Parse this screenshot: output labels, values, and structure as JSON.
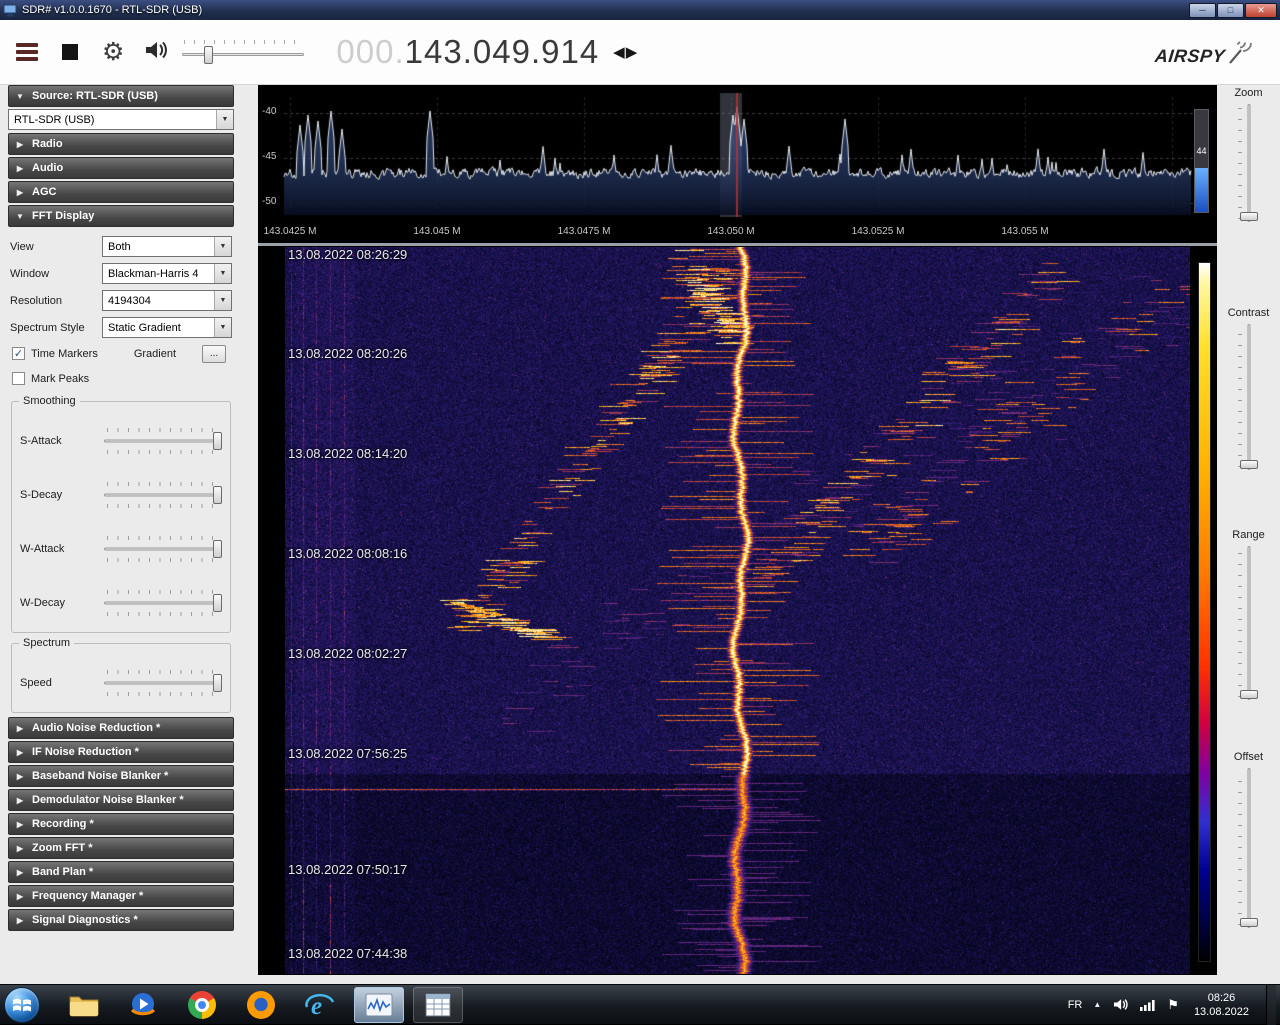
{
  "window": {
    "title": "SDR# v1.0.0.1670 - RTL-SDR (USB)"
  },
  "toolbar": {
    "frequency_dim": "000.",
    "frequency_main": "143.049.914",
    "brand": "AIRSPY"
  },
  "sidebar": {
    "panels": {
      "source": {
        "title": "Source: RTL-SDR (USB)",
        "value": "RTL-SDR (USB)"
      },
      "radio": "Radio",
      "audio": "Audio",
      "agc": "AGC",
      "fft": "FFT Display"
    },
    "fft": {
      "rows": [
        {
          "label": "View",
          "value": "Both"
        },
        {
          "label": "Window",
          "value": "Blackman-Harris 4"
        },
        {
          "label": "Resolution",
          "value": "4194304"
        },
        {
          "label": "Spectrum Style",
          "value": "Static Gradient"
        }
      ],
      "time_markers": "Time Markers",
      "gradient": "Gradient",
      "gradient_button": "...",
      "mark_peaks": "Mark Peaks",
      "smoothing_title": "Smoothing",
      "smoothing_sliders": [
        "S-Attack",
        "S-Decay",
        "W-Attack",
        "W-Decay"
      ],
      "spectrum_title": "Spectrum",
      "spectrum_sliders": [
        "Speed"
      ]
    },
    "collapsed": [
      "Audio Noise Reduction *",
      "IF Noise Reduction *",
      "Baseband Noise Blanker *",
      "Demodulator Noise Blanker *",
      "Recording *",
      "Zoom FFT *",
      "Band Plan *",
      "Frequency Manager *",
      "Signal Diagnostics *"
    ]
  },
  "spectrum": {
    "y_ticks": [
      "-40",
      "-45",
      "-50"
    ],
    "x_ticks": [
      "143.0425 M",
      "143.045 M",
      "143.0475 M",
      "143.050 M",
      "143.0525 M",
      "143.055 M"
    ],
    "meter_value": "44"
  },
  "waterfall": {
    "timestamps": [
      "13.08.2022 08:26:29",
      "13.08.2022 08:20:26",
      "13.08.2022 08:14:20",
      "13.08.2022 08:08:16",
      "13.08.2022 08:02:27",
      "13.08.2022 07:56:25",
      "13.08.2022 07:50:17",
      "13.08.2022 07:44:38"
    ]
  },
  "right_panel": {
    "labels": [
      "Zoom",
      "Contrast",
      "Range",
      "Offset"
    ]
  },
  "taskbar": {
    "language": "FR",
    "clock_time": "08:26",
    "clock_date": "13.08.2022"
  },
  "colors": {
    "tuning_line": "#c03030",
    "trace": "#ebeff6",
    "meter_fill": "#2a6fe0"
  }
}
